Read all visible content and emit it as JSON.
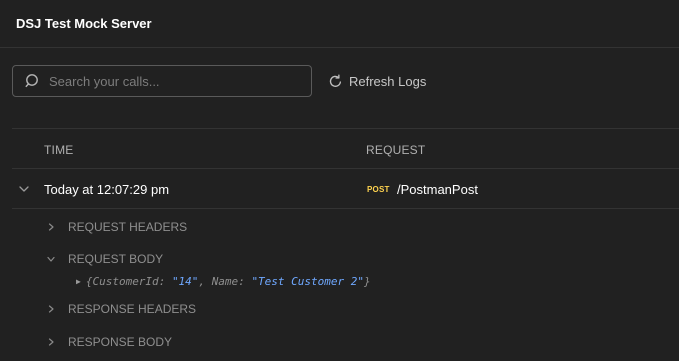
{
  "header": {
    "title": "DSJ Test Mock Server"
  },
  "search": {
    "placeholder": "Search your calls...",
    "value": ""
  },
  "toolbar": {
    "refresh_label": "Refresh Logs"
  },
  "table": {
    "columns": {
      "time": "TIME",
      "request": "REQUEST"
    },
    "rows": [
      {
        "time": "Today at 12:07:29 pm",
        "method": "POST",
        "path": "/PostmanPost",
        "sections": {
          "request_headers": "REQUEST HEADERS",
          "request_body": "REQUEST BODY",
          "response_headers": "RESPONSE HEADERS",
          "response_body": "RESPONSE BODY"
        },
        "body": {
          "open": "{",
          "key1": "CustomerId",
          "colon1": ": ",
          "val1": "\"14\"",
          "sep": ", ",
          "key2": "Name",
          "colon2": ": ",
          "val2": "\"Test Customer 2\"",
          "close": "}"
        }
      }
    ]
  },
  "colors": {
    "background": "#212121",
    "post_badge": "#ffd34f",
    "json_string": "#6fa8ff"
  },
  "icons": {
    "search": "search-icon",
    "refresh": "refresh-icon",
    "chevron_down": "chevron-down-icon",
    "chevron_right": "chevron-right-icon"
  }
}
